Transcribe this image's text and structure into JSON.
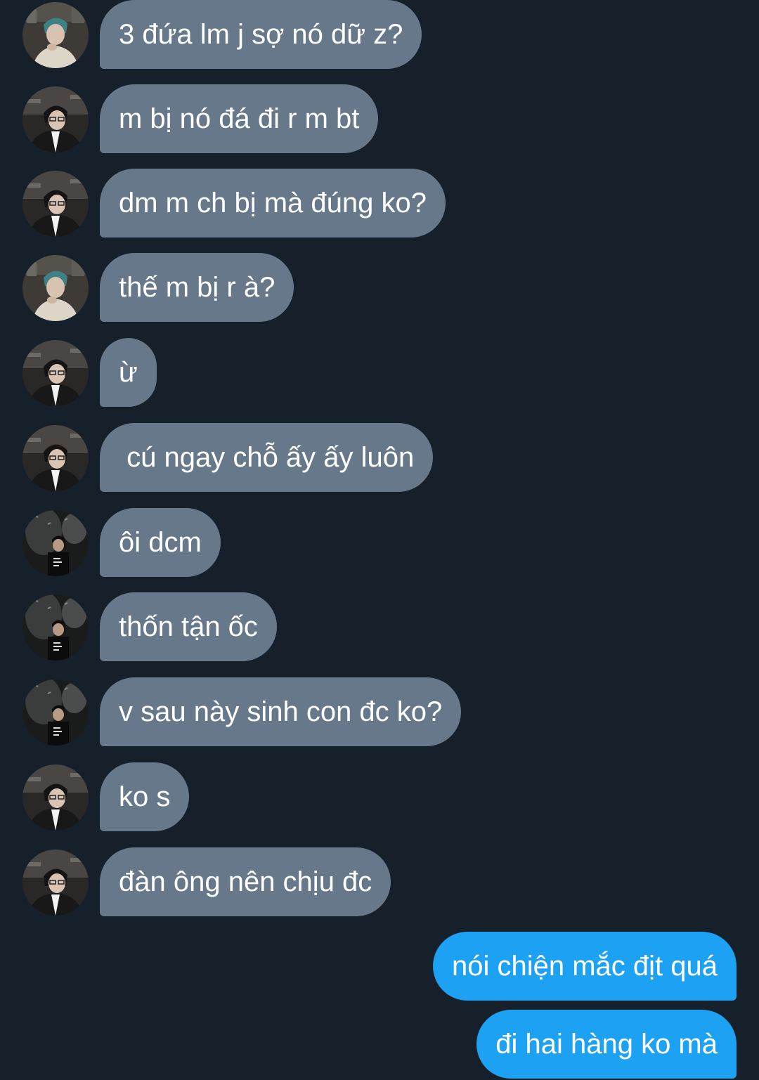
{
  "conversation": {
    "messages": [
      {
        "text": "3 đứa lm j sợ nó dữ z?",
        "direction": "incoming",
        "avatar": "avatar-teal-hair"
      },
      {
        "text": "m bị nó đá đi r m bt",
        "direction": "incoming",
        "avatar": "avatar-glasses"
      },
      {
        "text": "dm m ch bị mà đúng ko?",
        "direction": "incoming",
        "avatar": "avatar-glasses"
      },
      {
        "text": "thế m bị r à?",
        "direction": "incoming",
        "avatar": "avatar-teal-hair"
      },
      {
        "text": "ừ",
        "direction": "incoming",
        "avatar": "avatar-glasses"
      },
      {
        "text": " cú ngay chỗ ấy ấy luôn",
        "direction": "incoming",
        "avatar": "avatar-glasses"
      },
      {
        "text": "ôi dcm",
        "direction": "incoming",
        "avatar": "avatar-cap"
      },
      {
        "text": "thốn tận ốc",
        "direction": "incoming",
        "avatar": "avatar-cap"
      },
      {
        "text": "v sau này sinh con đc ko?",
        "direction": "incoming",
        "avatar": "avatar-cap"
      },
      {
        "text": "ko s",
        "direction": "incoming",
        "avatar": "avatar-glasses"
      },
      {
        "text": "đàn ông nên chịu đc",
        "direction": "incoming",
        "avatar": "avatar-glasses"
      },
      {
        "text": "nói chiện mắc địt quá",
        "direction": "outgoing"
      },
      {
        "text": "đi hai hàng ko mà",
        "direction": "outgoing"
      }
    ]
  },
  "colors": {
    "background": "#16202b",
    "incoming_bubble": "#66788a",
    "outgoing_bubble": "#1da1f2",
    "text": "#ffffff"
  }
}
